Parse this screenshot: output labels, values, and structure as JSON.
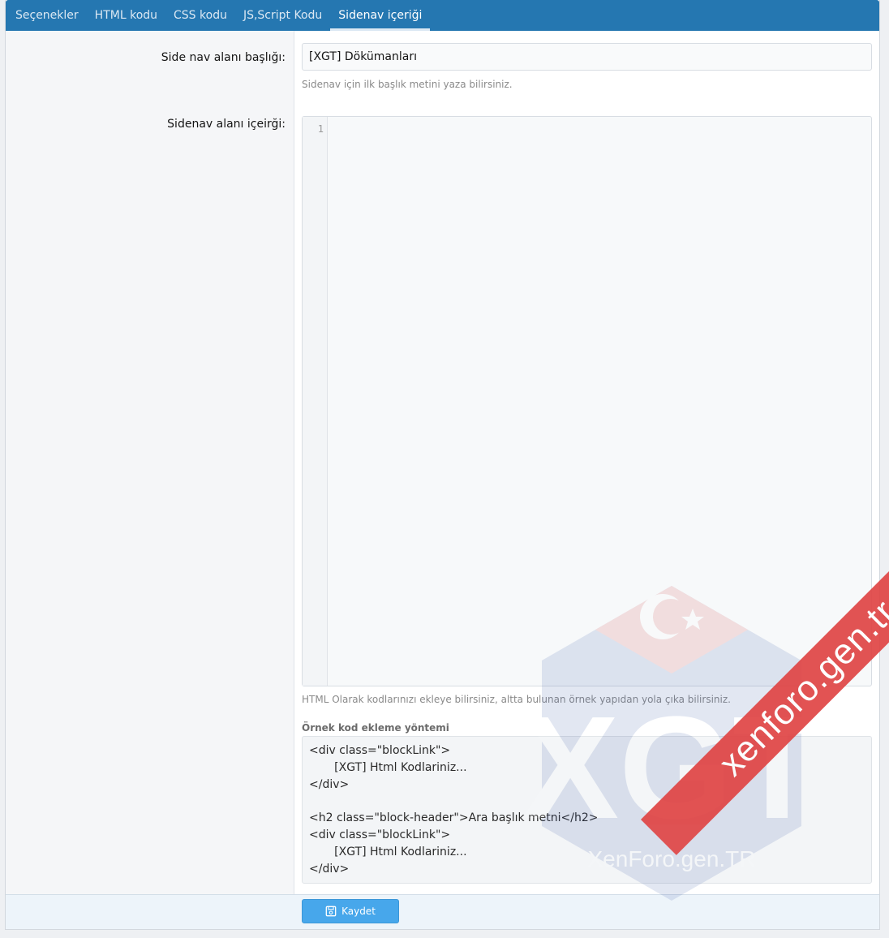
{
  "tabs": [
    {
      "label": "Seçenekler",
      "active": false
    },
    {
      "label": "HTML kodu",
      "active": false
    },
    {
      "label": "CSS kodu",
      "active": false
    },
    {
      "label": "JS,Script Kodu",
      "active": false
    },
    {
      "label": "Sidenav içeriği",
      "active": true
    }
  ],
  "form": {
    "title_label": "Side nav alanı başlığı:",
    "title_value": "[XGT] Dökümanları",
    "title_hint": "Sidenav için ilk başlık metini yaza bilirsiniz.",
    "content_label": "Sidenav alanı içeirği:",
    "editor_line_number": "1",
    "content_hint": "HTML Olarak kodlarınızı ekleye bilirsiniz, altta bulunan örnek yapıdan yola çıka bilirsiniz.",
    "example_title": "Örnek kod ekleme yöntemi",
    "example_lines": [
      "<div class=\"blockLink\">",
      "       [XGT] Html Kodlariniz...",
      "</div>",
      "",
      "<h2 class=\"block-header\">Ara başlık metni</h2>",
      "<div class=\"blockLink\">",
      "       [XGT] Html Kodlariniz...",
      "</div>"
    ]
  },
  "footer": {
    "save_label": "Kaydet",
    "save_icon": "save-icon"
  },
  "watermark": {
    "logo_text": "XGT",
    "logo_subtext": "XenForo.gen.TR",
    "ribbon_text": "xenforo.gen.tr",
    "accent_red": "#e04545"
  },
  "colors": {
    "tab_bar": "#2577b1",
    "button": "#47a7eb"
  }
}
